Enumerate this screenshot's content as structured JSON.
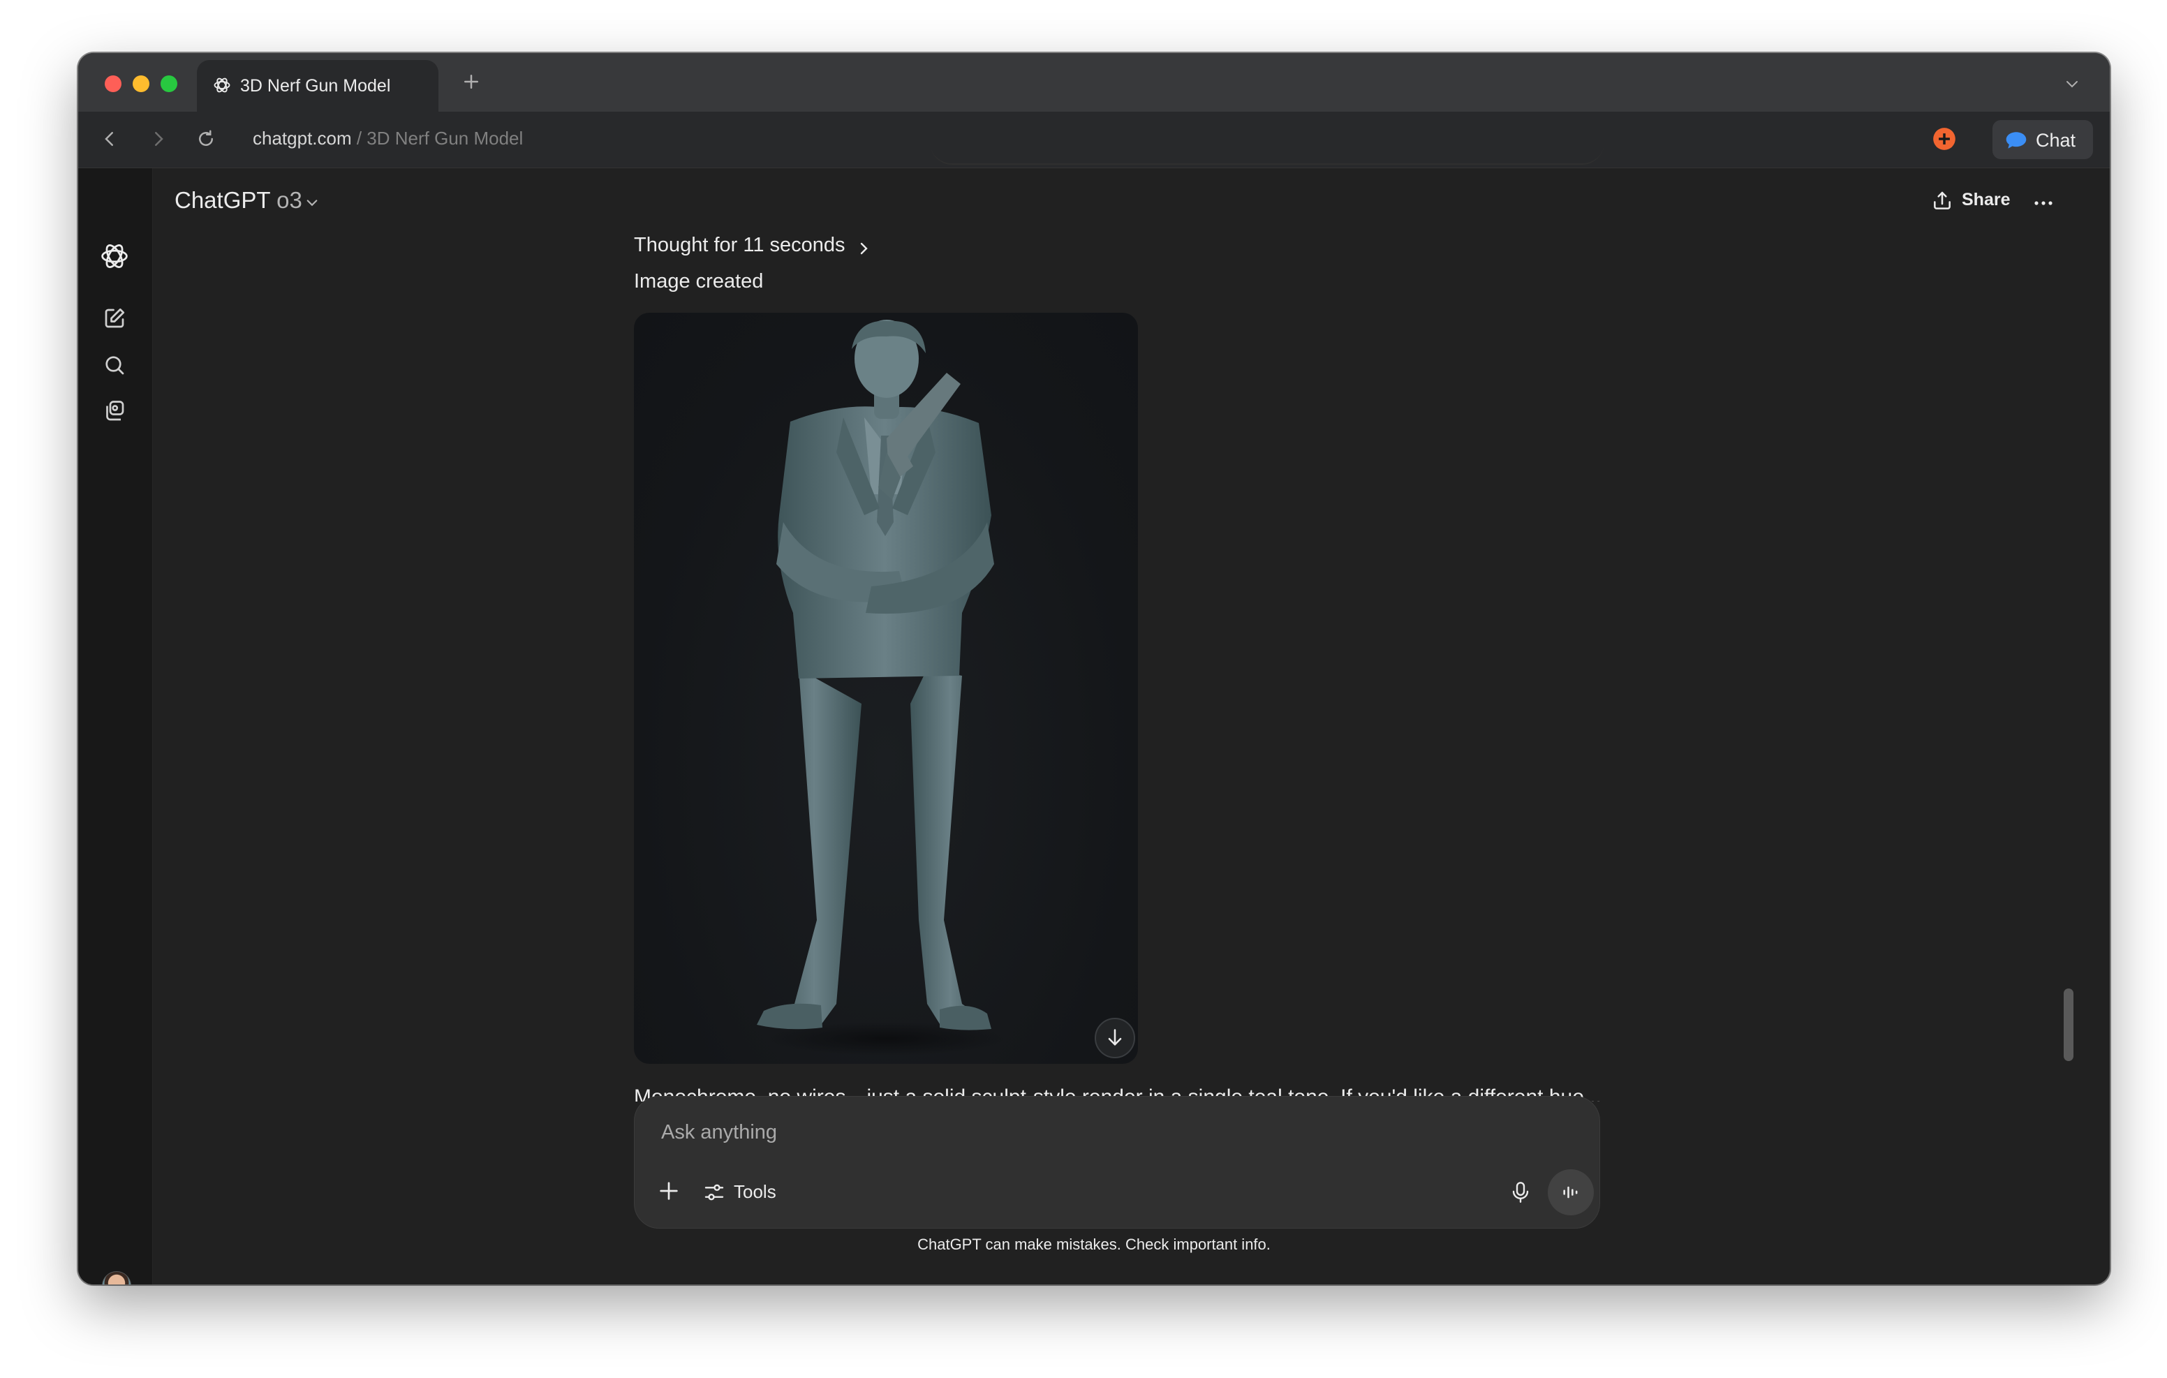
{
  "browser": {
    "tab_title": "3D Nerf Gun Model",
    "url_host": "chatgpt.com",
    "url_path": " / 3D Nerf Gun Model",
    "chat_button_label": "Chat",
    "colors": {
      "extension_accent": "#f26530",
      "chat_icon": "#3b8ef5"
    }
  },
  "sidebar": {
    "icons": [
      "openai-logo-icon",
      "new-chat-icon",
      "search-icon",
      "library-icon"
    ],
    "avatar": "user-avatar"
  },
  "header": {
    "model_name": "ChatGPT",
    "model_version": "o3",
    "share_label": "Share"
  },
  "conversation": {
    "thought_label": "Thought for 11 seconds",
    "image_status": "Image created",
    "truncated_text": "Monochrome, no wires—just a solid sculpt-style render in a single teal tone. If you'd like a different hue..."
  },
  "composer": {
    "placeholder": "Ask anything",
    "tools_label": "Tools"
  },
  "footer": {
    "disclaimer": "ChatGPT can make mistakes. Check important info."
  }
}
